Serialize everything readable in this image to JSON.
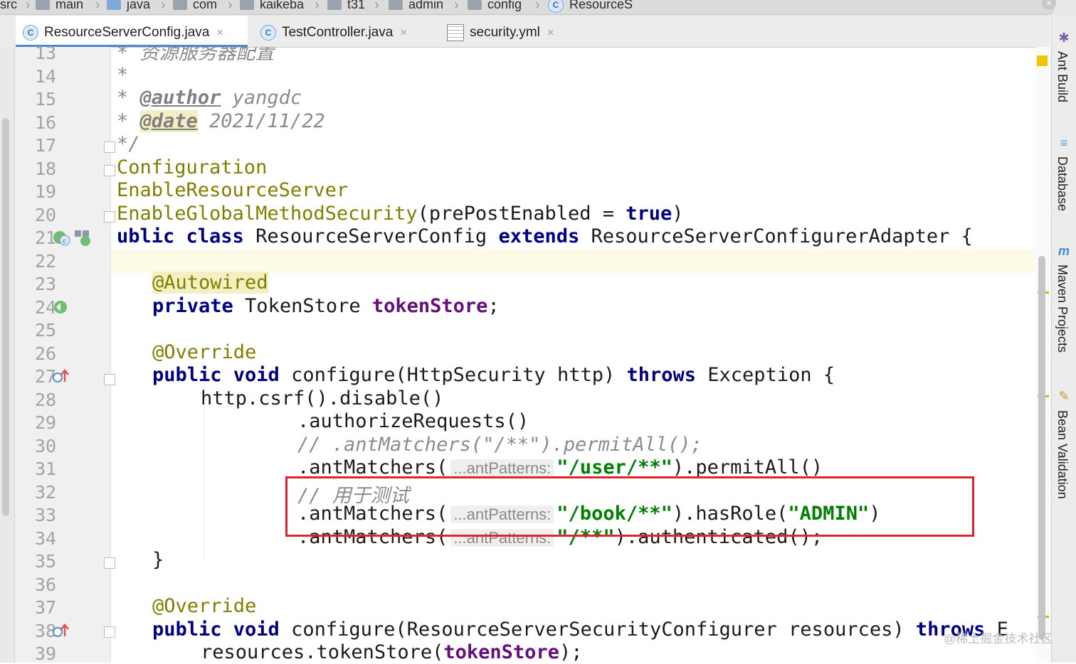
{
  "breadcrumb": {
    "items": [
      "src",
      "main",
      "java",
      "com",
      "kaikeba",
      "t31",
      "admin",
      "config",
      "ResourceS"
    ]
  },
  "tabs": [
    {
      "label": "ResourceServerConfig.java",
      "active": true
    },
    {
      "label": "TestController.java",
      "active": false
    },
    {
      "label": "security.yml",
      "active": false
    }
  ],
  "tab_close_glyph": "×",
  "tool_windows": [
    "Ant Build",
    "Database",
    "Maven Projects",
    "Bean Validation"
  ],
  "editor": {
    "line_numbers": [
      "13",
      "14",
      "15",
      "16",
      "17",
      "18",
      "19",
      "20",
      "21",
      "22",
      "23",
      "24",
      "25",
      "26",
      "27",
      "28",
      "29",
      "30",
      "31",
      "32",
      "33",
      "34",
      "35",
      "36",
      "37",
      "38",
      "39"
    ],
    "lines": {
      "l13": {
        "a": "* ",
        "b": "资源服务器配置"
      },
      "l14": {
        "a": "*"
      },
      "l15": {
        "a": "* ",
        "tag": "@author",
        "b": " yangdc"
      },
      "l16": {
        "a": "* ",
        "tag": "@date",
        "b": " 2021/11/22"
      },
      "l17": {
        "a": "*/"
      },
      "l18": {
        "ann": "Configuration"
      },
      "l19": {
        "ann": "EnableResourceServer"
      },
      "l20": {
        "ann": "EnableGlobalMethodSecurity",
        "b": "(prePostEnabled = ",
        "kw": "true",
        "c": ")"
      },
      "l21": {
        "kw1": "ublic class",
        "b": " ResourceServerConfig ",
        "kw2": "extends",
        "c": " ResourceServerConfigurerAdapter {"
      },
      "l23": {
        "ann": "@Autowired"
      },
      "l24": {
        "kw": "private",
        "b": " TokenStore ",
        "fld": "tokenStore",
        "c": ";"
      },
      "l26": {
        "ann": "@Override"
      },
      "l27": {
        "kw1": "public void",
        "b": " configure(HttpSecurity http) ",
        "kw2": "throws",
        "c": " Exception {"
      },
      "l28": {
        "a": "http.csrf().disable()"
      },
      "l29": {
        "a": ".authorizeRequests()"
      },
      "l30": {
        "cmt": "// .antMatchers(\"/**\").permitAll();"
      },
      "l31": {
        "a": ".antMatchers(",
        "hint": "...antPatterns:",
        "str": "\"/user/**\"",
        "b": ").permitAll()"
      },
      "l32": {
        "cmt": "// 用于测试"
      },
      "l33": {
        "a": ".antMatchers(",
        "hint": "...antPatterns:",
        "str": "\"/book/**\"",
        "b": ").hasRole(",
        "str2": "\"ADMIN\"",
        "c": ")"
      },
      "l34": {
        "a": ".antMatchers(",
        "hint": "...antPatterns:",
        "str": "\"/**\"",
        "b": ").authenticated();"
      },
      "l35": {
        "a": "}"
      },
      "l37": {
        "ann": "@Override"
      },
      "l38": {
        "kw1": "public void",
        "b": " configure(ResourceServerSecurityConfigurer resources) ",
        "kw2": "throws",
        "c": " E"
      },
      "l39": {
        "a": "resources.tokenStore(",
        "fld": "tokenStore",
        "b": ");"
      }
    }
  },
  "watermark": "@稀土掘金技术社区",
  "colors": {
    "keyword": "#000080",
    "annotation": "#808000",
    "string": "#008000",
    "field": "#660e7a",
    "comment": "#8c8c8c",
    "highlight_box": "#e0242f",
    "active_tab_underline": "#4a88d0"
  }
}
